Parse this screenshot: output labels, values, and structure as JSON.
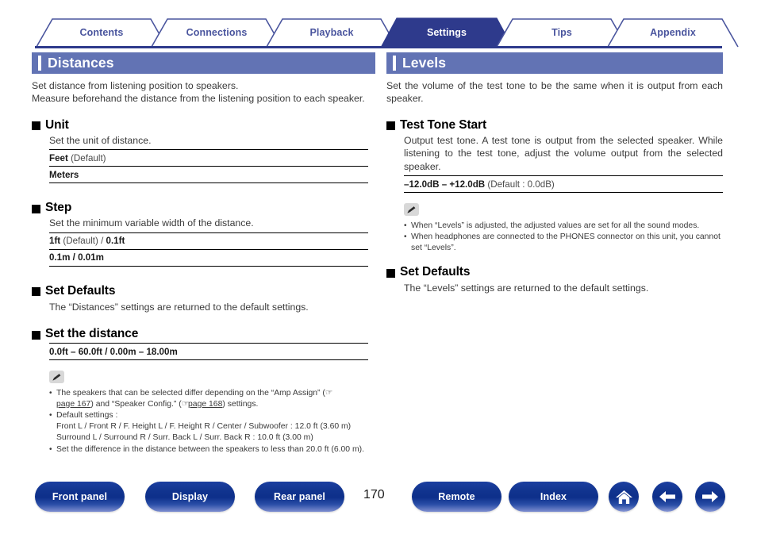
{
  "tabs": [
    {
      "label": "Contents",
      "active": false
    },
    {
      "label": "Connections",
      "active": false
    },
    {
      "label": "Playback",
      "active": false
    },
    {
      "label": "Settings",
      "active": true
    },
    {
      "label": "Tips",
      "active": false
    },
    {
      "label": "Appendix",
      "active": false
    }
  ],
  "left": {
    "section_title": "Distances",
    "intro_line1": "Set distance from listening position to speakers.",
    "intro_line2": "Measure beforehand the distance from the listening position to each speaker.",
    "unit": {
      "heading": "Unit",
      "desc": "Set the unit of distance.",
      "option1_bold": "Feet",
      "option1_rest": " (Default)",
      "option2_bold": "Meters"
    },
    "step": {
      "heading": "Step",
      "desc": "Set the minimum variable width of the distance.",
      "option1_a": "1ft",
      "option1_mid": " (Default) / ",
      "option1_b": "0.1ft",
      "option2_a": "0.1m",
      "option2_mid": " / ",
      "option2_b": "0.01m"
    },
    "set_defaults": {
      "heading": "Set Defaults",
      "desc": "The “Distances” settings are returned to the default settings."
    },
    "set_distance": {
      "heading": "Set the distance",
      "range": "0.0ft – 60.0ft / 0.00m – 18.00m"
    },
    "notes": {
      "note1_pre": "The speakers that can be selected differ depending on the “Amp Assign” (",
      "note1_ref1": "page 167",
      "note1_mid": ") and “Speaker Config.” (",
      "note1_ref2": "page 168",
      "note1_post": ") settings.",
      "note2": "Default settings :",
      "note2_line1": "Front L / Front R / F. Height L / F. Height R / Center / Subwoofer : 12.0 ft (3.60 m)",
      "note2_line2": "Surround L / Surround R / Surr. Back L / Surr. Back R : 10.0 ft (3.00 m)",
      "note3": "Set the difference in the distance between the speakers to less than 20.0 ft (6.00 m)."
    }
  },
  "right": {
    "section_title": "Levels",
    "intro": "Set the volume of the test tone to be the same when it is output from each speaker.",
    "test_tone": {
      "heading": "Test Tone Start",
      "desc": "Output test tone. A test tone is output from the selected speaker. While listening to the test tone, adjust the volume output from the selected speaker.",
      "range_bold": "–12.0dB – +12.0dB",
      "range_rest": " (Default : 0.0dB)"
    },
    "notes": {
      "note1": "When “Levels” is adjusted, the adjusted values are set for all the sound modes.",
      "note2": "When headphones are connected to the PHONES connector on this unit, you cannot set “Levels”."
    },
    "set_defaults": {
      "heading": "Set Defaults",
      "desc": "The “Levels” settings are returned to the default settings."
    }
  },
  "footer": {
    "buttons": [
      {
        "label": "Front panel"
      },
      {
        "label": "Display"
      },
      {
        "label": "Rear panel"
      },
      {
        "label": "Remote"
      },
      {
        "label": "Index"
      }
    ],
    "page_number": "170",
    "icons": [
      "home-icon",
      "arrow-left-icon",
      "arrow-right-icon"
    ]
  },
  "colors": {
    "tab_text": "#4a559e",
    "tab_active_bg": "#2e3a8c",
    "section_bar": "#6273b4",
    "rule": "#2e3a8c",
    "button_blue": "#11348f"
  }
}
